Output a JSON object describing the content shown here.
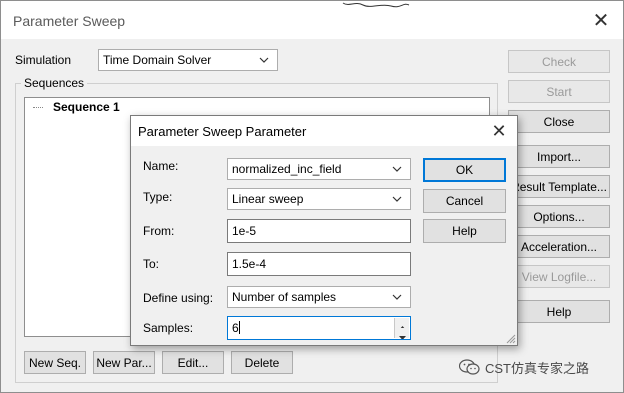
{
  "outer": {
    "title": "Parameter Sweep",
    "close_glyph": "✕",
    "simulation_label": "Simulation",
    "simulation_value": "Time Domain Solver",
    "sequences_label": "Sequences",
    "tree_item": "Sequence 1",
    "buttons_right": {
      "check": "Check",
      "start": "Start",
      "close": "Close",
      "import": "Import...",
      "result_template": "Result Template...",
      "options": "Options...",
      "acceleration": "Acceleration...",
      "view_logfile": "View Logfile...",
      "help": "Help"
    },
    "buttons_bottom": {
      "new_seq": "New Seq.",
      "new_par": "New Par...",
      "edit": "Edit...",
      "delete": "Delete"
    }
  },
  "dialog": {
    "title": "Parameter Sweep Parameter",
    "close_glyph": "✕",
    "name_label": "Name:",
    "name_value": "normalized_inc_field",
    "type_label": "Type:",
    "type_value": "Linear sweep",
    "from_label": "From:",
    "from_value": "1e-5",
    "to_label": "To:",
    "to_value": "1.5e-4",
    "define_label": "Define using:",
    "define_value": "Number of samples",
    "samples_label": "Samples:",
    "samples_value": "6",
    "ok": "OK",
    "cancel": "Cancel",
    "help": "Help"
  },
  "watermark": {
    "text": "CST仿真专家之路"
  },
  "icons": {
    "chevron": "chevron-down-icon",
    "spin_up": "spin-up-icon",
    "spin_down": "spin-down-icon",
    "wechat": "wechat-icon"
  }
}
